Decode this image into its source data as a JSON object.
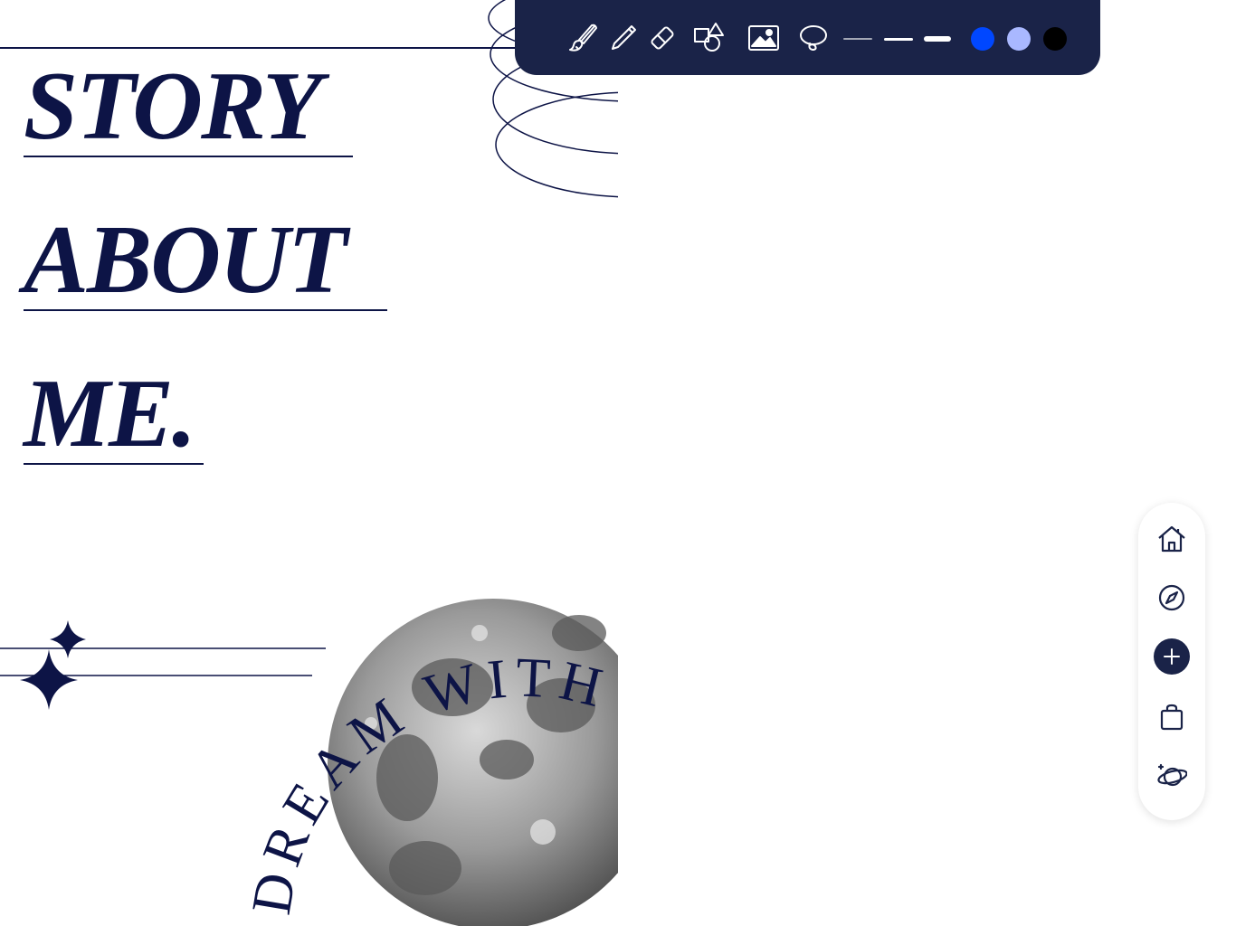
{
  "page": {
    "title_lines": [
      "STORY",
      "ABOUT",
      "ME."
    ],
    "circular_text": "DREAM WITH IRU"
  },
  "toolbar": {
    "tools": [
      {
        "name": "brush",
        "icon": "brush-icon"
      },
      {
        "name": "pen",
        "icon": "pen-icon"
      },
      {
        "name": "eraser",
        "icon": "eraser-icon"
      },
      {
        "name": "shapes",
        "icon": "shapes-icon"
      },
      {
        "name": "image",
        "icon": "image-icon"
      },
      {
        "name": "lasso",
        "icon": "lasso-icon"
      }
    ],
    "stroke_options": [
      "thin",
      "medium",
      "thick"
    ],
    "colors": [
      "#0047ff",
      "#a9b8ff",
      "#000000"
    ]
  },
  "sidenav": {
    "items": [
      {
        "name": "home",
        "icon": "home-icon"
      },
      {
        "name": "explore",
        "icon": "compass-icon"
      },
      {
        "name": "add",
        "icon": "plus-icon"
      },
      {
        "name": "shop",
        "icon": "shopping-bag-icon"
      },
      {
        "name": "planet",
        "icon": "planet-icon"
      }
    ]
  },
  "theme": {
    "navy": "#0d1446",
    "toolbar_bg": "#1a2348"
  }
}
